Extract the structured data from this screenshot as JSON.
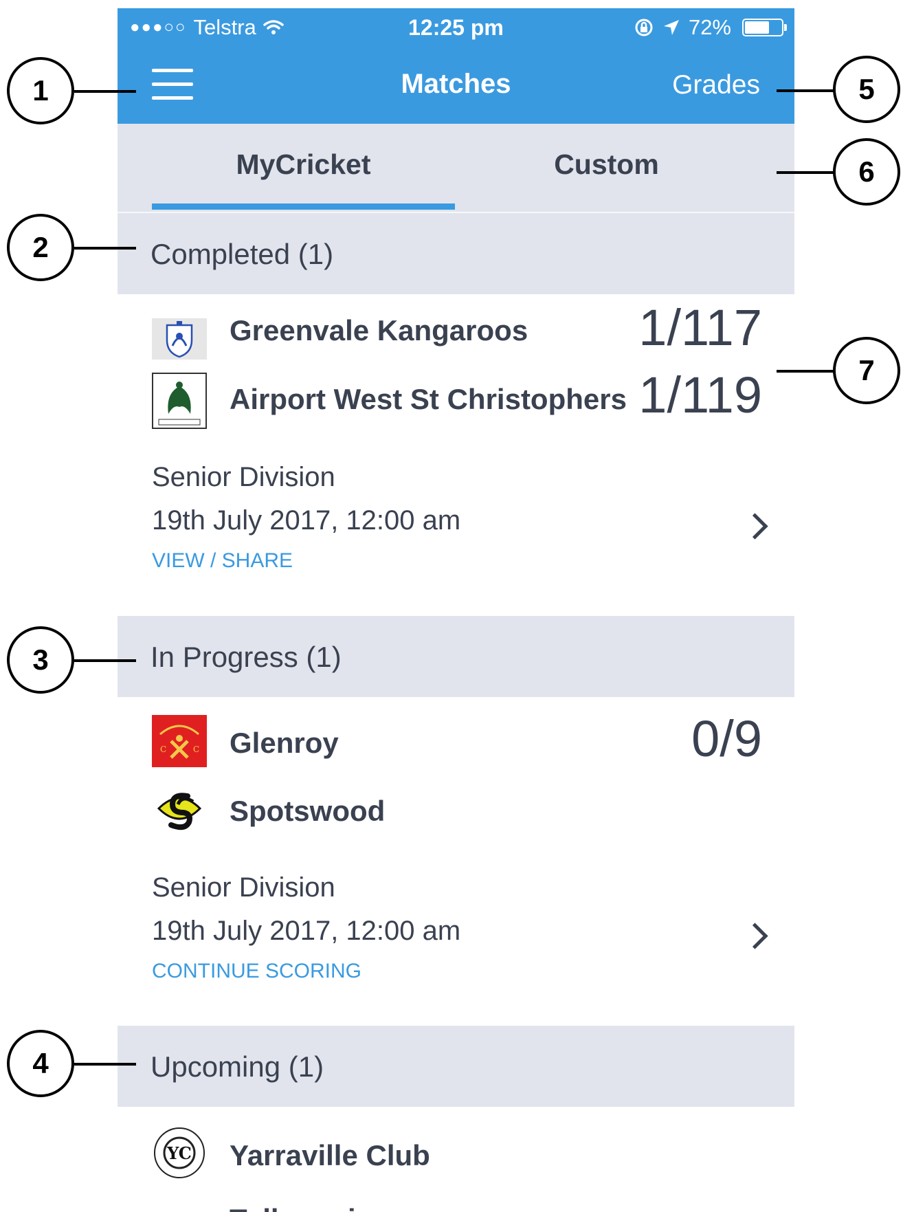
{
  "status_bar": {
    "signal": "●●●○○",
    "carrier": "Telstra",
    "time": "12:25 pm",
    "battery_percent": "72%",
    "battery_level": 0.72
  },
  "nav": {
    "title": "Matches",
    "right_button": "Grades"
  },
  "tabs": [
    {
      "label": "MyCricket",
      "active": true
    },
    {
      "label": "Custom",
      "active": false
    }
  ],
  "sections": [
    {
      "header": "Completed (1)",
      "match": {
        "team1": {
          "name": "Greenvale Kangaroos",
          "score": "1/117"
        },
        "team2": {
          "name": "Airport West St Christophers",
          "score": "1/119"
        },
        "division": "Senior Division",
        "datetime": "19th July 2017, 12:00 am",
        "action": "VIEW / SHARE"
      }
    },
    {
      "header": "In Progress (1)",
      "match": {
        "team1": {
          "name": "Glenroy",
          "score": "0/9"
        },
        "team2": {
          "name": "Spotswood",
          "score": ""
        },
        "division": "Senior Division",
        "datetime": "19th July 2017, 12:00 am",
        "action": "CONTINUE SCORING"
      }
    },
    {
      "header": "Upcoming (1)",
      "match": {
        "team1": {
          "name": "Yarraville Club",
          "score": ""
        },
        "team2": {
          "name": "Tullamarine",
          "score": ""
        }
      }
    }
  ],
  "callouts": [
    "1",
    "2",
    "3",
    "4",
    "5",
    "6",
    "7"
  ],
  "colors": {
    "accent": "#3a9ae0",
    "header_bg": "#e1e4ec",
    "text": "#3a4150"
  }
}
